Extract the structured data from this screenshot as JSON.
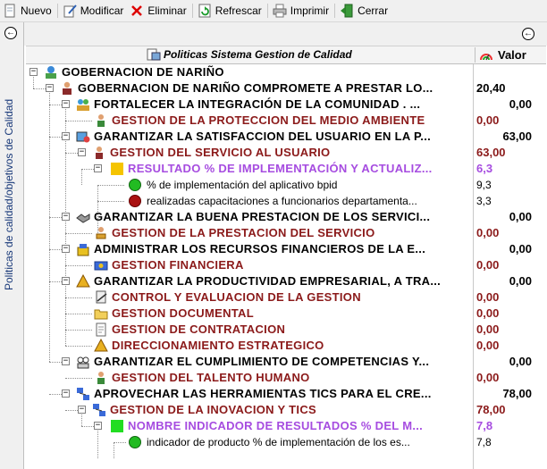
{
  "toolbar": {
    "nuevo": "Nuevo",
    "modificar": "Modificar",
    "eliminar": "Eliminar",
    "refrescar": "Refrescar",
    "imprimir": "Imprimir",
    "cerrar": "Cerrar"
  },
  "sidebar": {
    "vertical_title": "Politicas de calidad/objetivos de Calidad"
  },
  "tree": {
    "header_title": "Politicas Sistema Gestion de Calidad",
    "header_valor": "Valor",
    "rows": [
      {
        "label": "GOBERNACION DE NARIÑO",
        "value": ""
      },
      {
        "label": "GOBERNACION DE NARIÑO COMPROMETE A PRESTAR LO...",
        "value": "20,40"
      },
      {
        "label": "FORTALECER LA INTEGRACIÓN DE LA COMUNIDAD . ...",
        "value": "0,00"
      },
      {
        "label": "GESTION DE LA PROTECCION DEL MEDIO AMBIENTE",
        "value": "0,00"
      },
      {
        "label": "GARANTIZAR LA SATISFACCION DEL USUARIO EN LA P...",
        "value": "63,00"
      },
      {
        "label": "GESTION DEL SERVICIO AL USUARIO",
        "value": "63,00"
      },
      {
        "label": "RESULTADO % DE IMPLEMENTACIÓN Y ACTUALIZ...",
        "value": "6,3"
      },
      {
        "label": "% de implementación del aplicativo bpid",
        "value": "9,3"
      },
      {
        "label": "realizadas capacitaciones a funcionarios departamenta...",
        "value": "3,3"
      },
      {
        "label": "GARANTIZAR LA BUENA PRESTACION DE LOS SERVICI...",
        "value": "0,00"
      },
      {
        "label": "GESTION DE LA PRESTACION DEL SERVICIO",
        "value": "0,00"
      },
      {
        "label": "ADMINISTRAR LOS RECURSOS FINANCIEROS DE LA E...",
        "value": "0,00"
      },
      {
        "label": "GESTION FINANCIERA",
        "value": "0,00"
      },
      {
        "label": "GARANTIZAR LA PRODUCTIVIDAD EMPRESARIAL, A TRA...",
        "value": "0,00"
      },
      {
        "label": "CONTROL Y EVALUACION DE LA GESTION",
        "value": "0,00"
      },
      {
        "label": "GESTION DOCUMENTAL",
        "value": "0,00"
      },
      {
        "label": "GESTION DE CONTRATACION",
        "value": "0,00"
      },
      {
        "label": "DIRECCIONAMIENTO ESTRATEGICO",
        "value": "0,00"
      },
      {
        "label": "GARANTIZAR EL CUMPLIMIENTO DE COMPETENCIAS Y...",
        "value": "0,00"
      },
      {
        "label": "GESTION DEL TALENTO HUMANO",
        "value": "0,00"
      },
      {
        "label": "APROVECHAR LAS HERRAMIENTAS TICS PARA EL CRE...",
        "value": "78,00"
      },
      {
        "label": "GESTION DE LA INOVACION Y TICS",
        "value": "78,00"
      },
      {
        "label": "NOMBRE INDICADOR DE RESULTADOS % DEL M...",
        "value": "7,8"
      },
      {
        "label": "indicador de producto % de implementación de los es...",
        "value": "7,8"
      }
    ]
  },
  "colors": {
    "process_red": "#8b1a1a",
    "indicator_purple": "#a64ce0",
    "indicator_orange": "#f5c400",
    "indicator_green": "#22cc22"
  }
}
